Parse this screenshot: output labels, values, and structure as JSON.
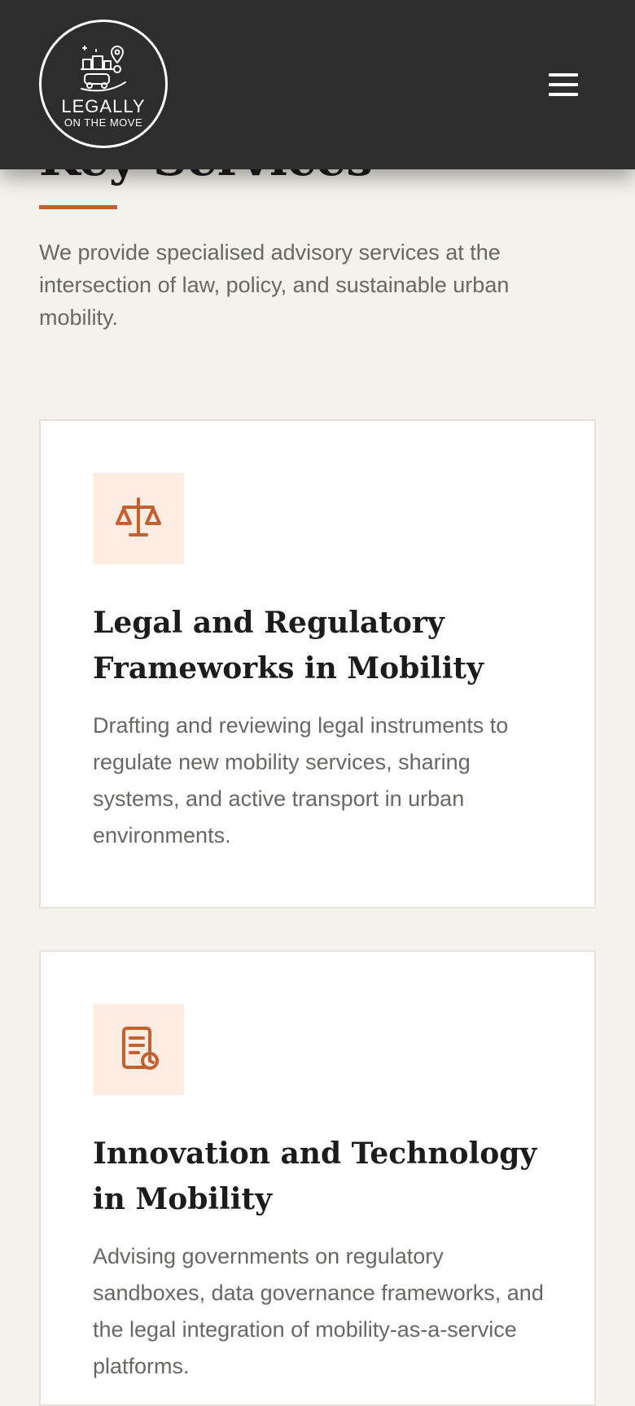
{
  "header": {
    "logo": {
      "wordmark": "LEGALLY",
      "tagline": "ON THE MOVE",
      "icon": "city-mobility-logo-icon"
    },
    "menu_icon": "hamburger-menu-icon"
  },
  "section": {
    "title": "Key Services",
    "intro": "We provide specialised advisory services at the intersection of law, policy, and sustainable urban mobility."
  },
  "services": [
    {
      "icon": "scales-of-justice-icon",
      "title": "Legal and Regulatory Frameworks in Mobility",
      "description": "Drafting and reviewing legal instruments to regulate new mobility services, sharing systems, and active transport in urban environments."
    },
    {
      "icon": "document-clock-icon",
      "title": "Innovation and Technology in Mobility",
      "description": "Advising governments on regulatory sandboxes, data governance frameworks, and the legal integration of mobility-as-a-service platforms."
    }
  ],
  "colors": {
    "header_bg": "#2d2d2d",
    "page_bg": "#f5f1ec",
    "accent": "#c2612f",
    "icon_bg": "#fdece2",
    "heading": "#1c1c1c",
    "body_text": "#6a6664"
  }
}
